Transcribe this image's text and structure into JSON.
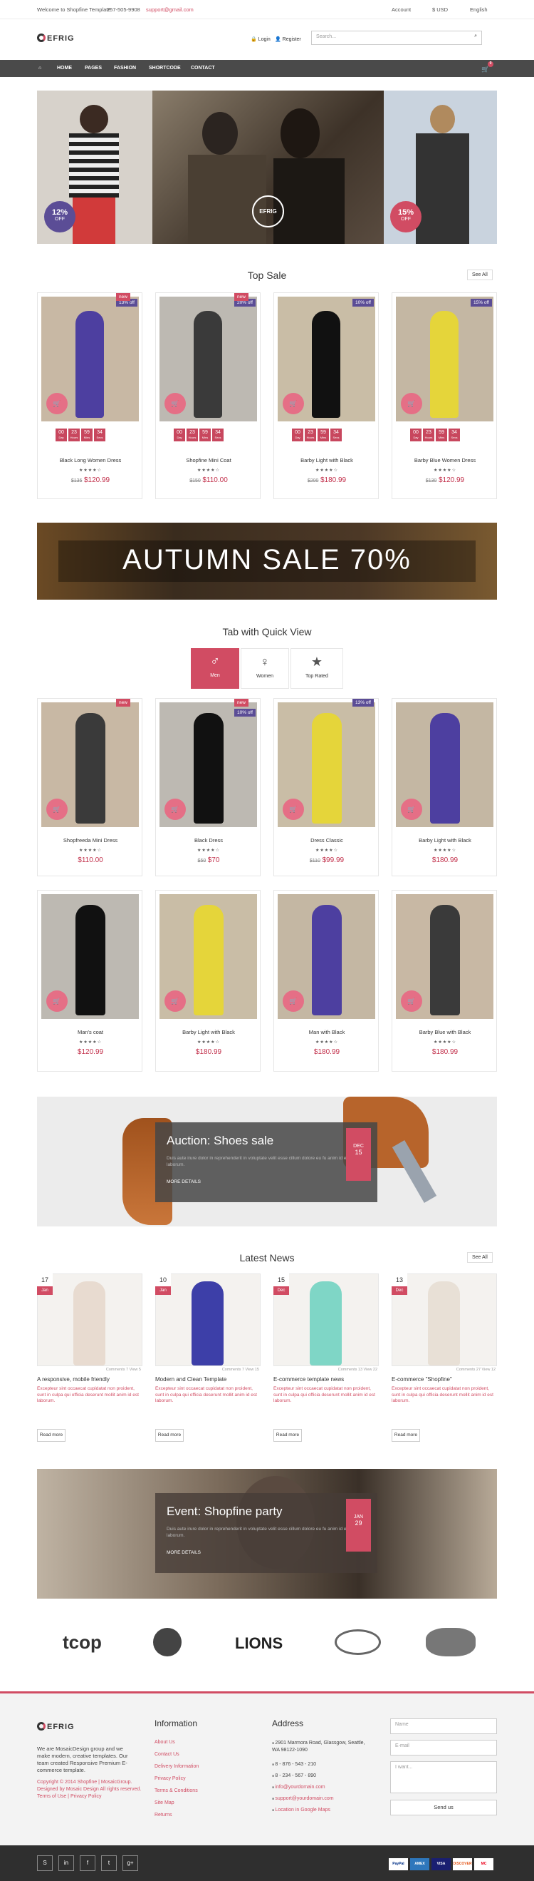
{
  "topbar": {
    "welcome": "Welcome to Shopfine Template",
    "phone": "757-505-9908",
    "email": "support@gmail.com",
    "account": "Account",
    "currency": "$ USD",
    "language": "English"
  },
  "header": {
    "logo": "EFRIG",
    "login": "Login",
    "register": "Register",
    "search_placeholder": "Search..."
  },
  "nav": {
    "items": [
      "HOME",
      "PAGES",
      "FASHION",
      "SHORTCODE",
      "CONTACT"
    ],
    "cart_count": "0"
  },
  "banner": {
    "left_badge_pct": "12%",
    "left_badge_label": "OFF",
    "right_badge_pct": "15%",
    "right_badge_label": "OFF",
    "center_logo": "EFRIG"
  },
  "top_sale": {
    "title": "Top Sale",
    "see_all": "See All",
    "timer_labels": [
      "Day",
      "Hours",
      "Mins",
      "Secs"
    ],
    "timer_values": [
      "00",
      "23",
      "59",
      "34"
    ],
    "products": [
      {
        "name": "Black Long Women Dress",
        "old": "$135",
        "price": "$120.99",
        "badge": "13% off",
        "new": "new"
      },
      {
        "name": "Shopfine Mini Coat",
        "old": "$150",
        "price": "$110.00",
        "badge": "20% off",
        "new": "new"
      },
      {
        "name": "Barby Light with Black",
        "old": "$200",
        "price": "$180.99",
        "badge": "10% off"
      },
      {
        "name": "Barby Blue Women Dress",
        "old": "$130",
        "price": "$120.99",
        "badge": "15% off"
      }
    ]
  },
  "autumn": {
    "text": "AUTUMN SALE 70%"
  },
  "tabs": {
    "title": "Tab with Quick View",
    "items": [
      "Men",
      "Women",
      "Top Rated"
    ],
    "row1": [
      {
        "name": "Shopfreeda Mini Dress",
        "price": "$110.00",
        "badge": "new"
      },
      {
        "name": "Black Dress",
        "old": "$50",
        "price": "$70",
        "badge": "10% off",
        "new": "new"
      },
      {
        "name": "Dress Classic",
        "old": "$110",
        "price": "$99.99",
        "badge": "13% off"
      },
      {
        "name": "Barby Light with Black",
        "price": "$180.99"
      }
    ],
    "row2": [
      {
        "name": "Man's coat",
        "price": "$120.99"
      },
      {
        "name": "Barby Light with Black",
        "price": "$180.99"
      },
      {
        "name": "Man with Black",
        "price": "$180.99"
      },
      {
        "name": "Barby Blue with Black",
        "price": "$180.99"
      }
    ]
  },
  "auction": {
    "title": "Auction: Shoes sale",
    "desc": "Duis aute irure dolor in reprehenderit in voluptate velit esse cillum dolore eu fu anim id est laborum.",
    "more": "MORE DETAILS",
    "month": "DEC",
    "day": "15"
  },
  "news": {
    "title": "Latest News",
    "see_all": "See All",
    "read_more": "Read more",
    "items": [
      {
        "day": "17",
        "month": "Jan",
        "title": "A responsive, mobile friendly",
        "meta": "Comments 7   View 5"
      },
      {
        "day": "10",
        "month": "Jan",
        "title": "Modern and Clean Template",
        "meta": "Comments 7   View 15"
      },
      {
        "day": "15",
        "month": "Dec",
        "title": "E-commerce template news",
        "meta": "Comments 13   View 22"
      },
      {
        "day": "13",
        "month": "Dec",
        "title": "E-commerce \"Shopfine\"",
        "meta": "Comments 27   View 12"
      }
    ],
    "excerpt": "Excepteur sint occaecat cupidatat non proident, sunt in culpa qui officia deserunt mollit anim id est laborum."
  },
  "event": {
    "title": "Event: Shopfine party",
    "desc": "Duis aute irure dolor in reprehenderit in voluptate velit esse cillum dolore eu fu anim id est laborum.",
    "more": "MORE DETAILS",
    "month": "JAN",
    "day": "29"
  },
  "brands": [
    "tcop",
    "LIONS"
  ],
  "footer": {
    "logo": "EFRIG",
    "about": "We are MosaicDesign group and we make modern, creative templates. Our team created Responsive Premium E-commerce template.",
    "copyright": "Copyright © 2014 Shopfine | MosaicGroup. Designed by Mosaic Design All rights reserved. Terms of Use | Privacy Policy",
    "info_title": "Information",
    "info_links": [
      "About Us",
      "Contact Us",
      "Delivery Information",
      "Privacy Policy",
      "Terms & Conditions",
      "Site Map",
      "Returns"
    ],
    "address_title": "Address",
    "address": [
      "2901 Marmora Road, Glassgow, Seattle, WA 98122-1090",
      "8 - 876 - 543 - 210",
      "8 - 234 - 567 - 890",
      "info@yourdomain.com",
      "support@yourdomain.com",
      "Location in Google Maps"
    ],
    "form": {
      "name": "Name",
      "email": "E-mail",
      "message": "I want...",
      "send": "Send us"
    },
    "social": [
      "S",
      "in",
      "f",
      "t",
      "g+"
    ],
    "payments": [
      "PayPal",
      "AMEX",
      "VISA",
      "DISCOVER",
      "MC"
    ]
  }
}
